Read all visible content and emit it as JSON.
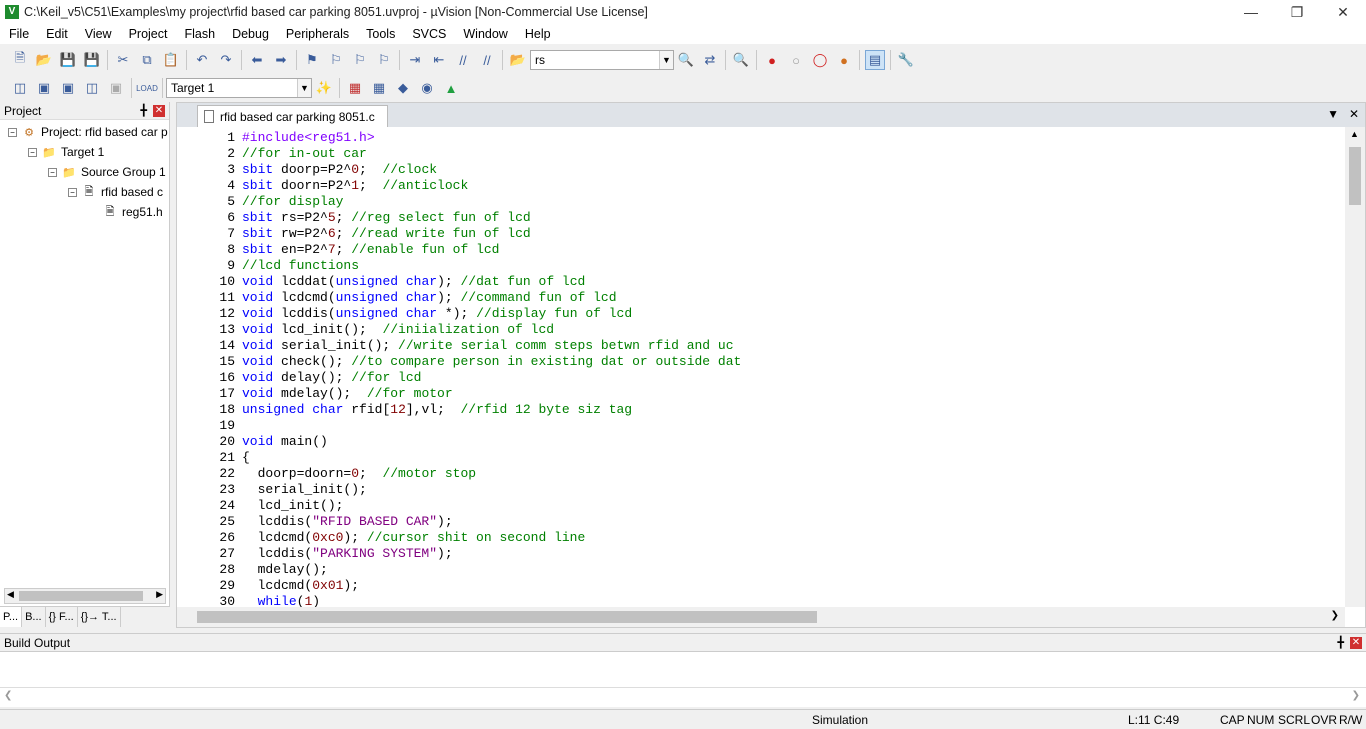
{
  "window": {
    "title": "C:\\Keil_v5\\C51\\Examples\\my project\\rfid based car parking 8051.uvproj - µVision  [Non-Commercial Use License]",
    "icon": "uvision-app-icon"
  },
  "menu": [
    "File",
    "Edit",
    "View",
    "Project",
    "Flash",
    "Debug",
    "Peripherals",
    "Tools",
    "SVCS",
    "Window",
    "Help"
  ],
  "toolbar": {
    "find_value": "rs",
    "target_value": "Target 1"
  },
  "project_panel": {
    "title": "Project",
    "tree": {
      "project": "Project: rfid based car p",
      "target": "Target 1",
      "group": "Source Group 1",
      "file": "rfid based c",
      "header": "reg51.h"
    },
    "tabs": [
      "P...",
      "B...",
      "{} F...",
      "{}→ T..."
    ]
  },
  "editor": {
    "tab": "rfid based car parking 8051.c",
    "lines": [
      "#include<reg51.h>",
      "//for in-out car",
      "sbit doorp=P2^0;  //clock",
      "sbit doorn=P2^1;  //anticlock",
      "//for display",
      "sbit rs=P2^5; //reg select fun of lcd",
      "sbit rw=P2^6; //read write fun of lcd",
      "sbit en=P2^7; //enable fun of lcd",
      "//lcd functions",
      "void lcddat(unsigned char); //dat fun of lcd",
      "void lcdcmd(unsigned char); //command fun of lcd",
      "void lcddis(unsigned char *); //display fun of lcd",
      "void lcd_init();  //iniialization of lcd",
      "void serial_init(); //write serial comm steps betwn rfid and uc",
      "void check(); //to compare person in existing dat or outside dat",
      "void delay(); //for lcd",
      "void mdelay();  //for motor",
      "unsigned char rfid[12],vl;  //rfid 12 byte siz tag",
      "",
      "void main()",
      "{",
      "  doorp=doorn=0;  //motor stop",
      "  serial_init();",
      "  lcd_init();",
      "  lcddis(\"RFID BASED CAR\");",
      "  lcdcmd(0xc0); //cursor shit on second line",
      "  lcddis(\"PARKING SYSTEM\");",
      "  mdelay();",
      "  lcdcmd(0x01);",
      "  while(1)"
    ]
  },
  "build_output": {
    "title": "Build Output"
  },
  "status": {
    "mode": "Simulation",
    "position": "L:11 C:49",
    "cap": "CAP",
    "num": "NUM",
    "scrl": "SCRL",
    "ovr": "OVR",
    "rw": "R/W"
  },
  "colors": {
    "keyword": "#0000ff",
    "comment": "#008000",
    "string": "#800080",
    "preprocessor": "#8000ff",
    "number": "#800000"
  }
}
